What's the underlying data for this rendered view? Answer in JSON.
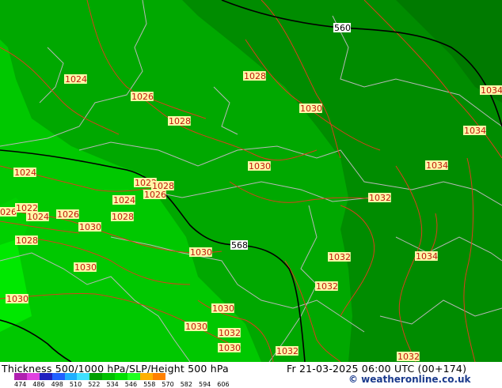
{
  "map": {
    "pressure_labels": [
      {
        "text": "1024",
        "color": "#c0180c"
      },
      {
        "text": "1028",
        "color": "#c0180c"
      },
      {
        "text": "1026",
        "color": "#c0180c"
      },
      {
        "text": "1028",
        "color": "#c0180c"
      },
      {
        "text": "1030",
        "color": "#c0180c"
      },
      {
        "text": "1034",
        "color": "#c0180c"
      },
      {
        "text": "1034",
        "color": "#c0180c"
      },
      {
        "text": "1024",
        "color": "#c0180c"
      },
      {
        "text": "1030",
        "color": "#c0180c"
      },
      {
        "text": "1034",
        "color": "#c0180c"
      },
      {
        "text": "1022",
        "color": "#c0180c"
      },
      {
        "text": "1028",
        "color": "#c0180c"
      },
      {
        "text": "1026",
        "color": "#c0180c"
      },
      {
        "text": "1024",
        "color": "#c0180c"
      },
      {
        "text": "1032",
        "color": "#c0180c"
      },
      {
        "text": "026",
        "color": "#c0180c"
      },
      {
        "text": "1022",
        "color": "#c0180c"
      },
      {
        "text": "1024",
        "color": "#c0180c"
      },
      {
        "text": "1026",
        "color": "#c0180c"
      },
      {
        "text": "1028",
        "color": "#c0180c"
      },
      {
        "text": "1030",
        "color": "#c0180c"
      },
      {
        "text": "1028",
        "color": "#c0180c"
      },
      {
        "text": "1030",
        "color": "#c0180c"
      },
      {
        "text": "1032",
        "color": "#c0180c"
      },
      {
        "text": "1034",
        "color": "#c0180c"
      },
      {
        "text": "1030",
        "color": "#c0180c"
      },
      {
        "text": "1032",
        "color": "#c0180c"
      },
      {
        "text": "1030",
        "color": "#c0180c"
      },
      {
        "text": "1030",
        "color": "#c0180c"
      },
      {
        "text": "1030",
        "color": "#c0180c"
      },
      {
        "text": "1032",
        "color": "#c0180c"
      },
      {
        "text": "1030",
        "color": "#c0180c"
      },
      {
        "text": "1032",
        "color": "#c0180c"
      },
      {
        "text": "1032",
        "color": "#c0180c"
      }
    ],
    "height_labels": [
      "560",
      "568"
    ],
    "colors": {
      "zone1": "#00e800",
      "zone2": "#00c800",
      "zone3": "#00a800",
      "zone4": "#008c00",
      "zone5": "#007a00",
      "isobar": "#d8401c",
      "height_line": "#000000",
      "border": "#b8b8b8"
    }
  },
  "footer": {
    "title": "Thickness 500/1000 hPa/SLP/Height 500 hPa",
    "time": "Fr 21-03-2025 06:00 UTC (00+174)",
    "credit": "© weatheronline.co.uk"
  },
  "legend": {
    "ticks": [
      "474",
      "486",
      "498",
      "510",
      "522",
      "534",
      "546",
      "558",
      "570",
      "582",
      "594",
      "606"
    ],
    "colors": [
      "#b020b0",
      "#e040e0",
      "#2020c0",
      "#2060ff",
      "#20b0ff",
      "#40e0ff",
      "#00a000",
      "#00c000",
      "#00e000",
      "#20ff20",
      "#ffb000",
      "#ff8000"
    ]
  }
}
